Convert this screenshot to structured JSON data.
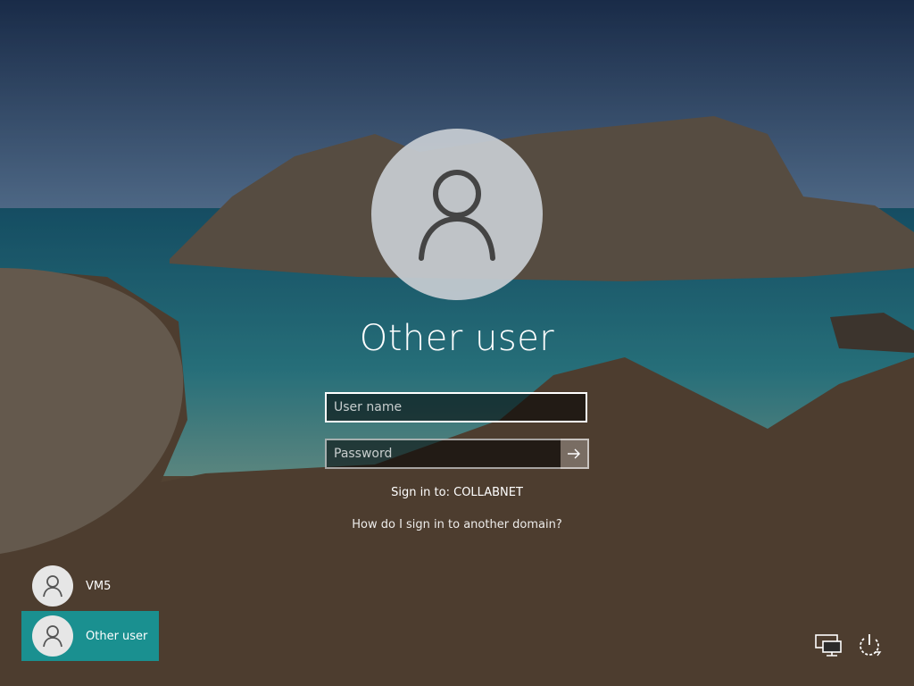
{
  "main": {
    "username": "Other user",
    "avatar_icon": "user-silhouette-icon",
    "username_field": {
      "placeholder": "User name",
      "value": ""
    },
    "password_field": {
      "placeholder": "Password",
      "value": ""
    },
    "submit_icon": "arrow-right-icon",
    "sign_in_to": "Sign in to: COLLABNET",
    "domain_help_link": "How do I sign in to another domain?"
  },
  "user_list": [
    {
      "label": "VM5",
      "selected": false,
      "icon": "user-silhouette-icon"
    },
    {
      "label": "Other user",
      "selected": true,
      "icon": "user-silhouette-icon"
    }
  ],
  "corner_controls": [
    {
      "icon": "network-icon"
    },
    {
      "icon": "power-icon"
    }
  ],
  "colors": {
    "selected_tile": "#1a9090",
    "input_background": "rgba(0,0,0,0.55)",
    "avatar_circle": "#c8cdd2"
  }
}
